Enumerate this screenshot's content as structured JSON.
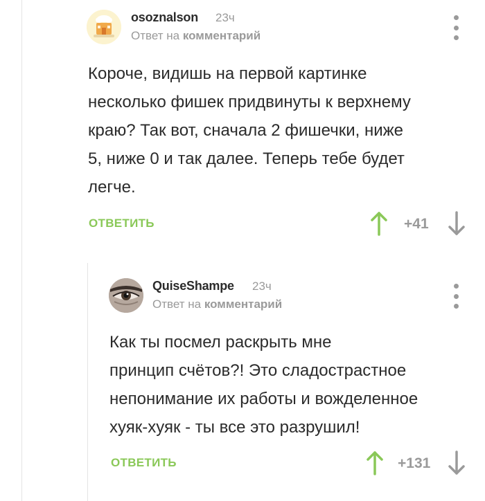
{
  "colors": {
    "accent_green": "#8ac858",
    "muted": "#9a9a9a",
    "text": "#2b2b2b"
  },
  "comments": [
    {
      "username": "osoznalson",
      "time": "23ч",
      "reply_prefix": "Ответ на",
      "reply_target": "комментарий",
      "body": "Короче, видишь на первой картинке\nнесколько фишек придвинуты к верхнему\nкраю? Так вот, сначала 2 фишечки, ниже\n5, ниже 0 и так далее. Теперь тебе будет\nлегче.",
      "reply_label": "ОТВЕТИТЬ",
      "rating": "+41",
      "avatar_icon": "house-cake-avatar"
    },
    {
      "username": "QuiseShampe",
      "time": "23ч",
      "reply_prefix": "Ответ на",
      "reply_target": "комментарий",
      "body": "Как ты посмел раскрыть мне\nпринцип счётов?! Это сладострастное\nнепонимание их работы и вожделенное\nхуяк-хуяк - ты все это разрушил!",
      "reply_label": "ОТВЕТИТЬ",
      "rating": "+131",
      "avatar_icon": "eye-avatar"
    }
  ]
}
